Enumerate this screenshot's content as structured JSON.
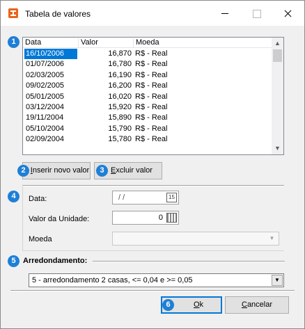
{
  "window": {
    "title": "Tabela de valores"
  },
  "markers": [
    "1",
    "2",
    "3",
    "4",
    "5",
    "6"
  ],
  "table": {
    "columns": [
      "Data",
      "Valor",
      "Moeda"
    ],
    "rows": [
      {
        "data": "16/10/2006",
        "valor": "16,870",
        "moeda": "R$ - Real"
      },
      {
        "data": "01/07/2006",
        "valor": "16,780",
        "moeda": "R$ - Real"
      },
      {
        "data": "02/03/2005",
        "valor": "16,190",
        "moeda": "R$ - Real"
      },
      {
        "data": "09/02/2005",
        "valor": "16,200",
        "moeda": "R$ - Real"
      },
      {
        "data": "05/01/2005",
        "valor": "16,020",
        "moeda": "R$ - Real"
      },
      {
        "data": "03/12/2004",
        "valor": "15,920",
        "moeda": "R$ - Real"
      },
      {
        "data": "19/11/2004",
        "valor": "15,890",
        "moeda": "R$ - Real"
      },
      {
        "data": "05/10/2004",
        "valor": "15,790",
        "moeda": "R$ - Real"
      },
      {
        "data": "02/09/2004",
        "valor": "15,780",
        "moeda": "R$ - Real"
      }
    ],
    "selected_row": 0
  },
  "buttons": {
    "insert_key": "I",
    "insert_rest": "nserir novo valor",
    "delete_key": "E",
    "delete_rest": "xcluir valor",
    "ok_key": "O",
    "ok_rest": "k",
    "cancel_key": "C",
    "cancel_rest": "ancelar"
  },
  "form": {
    "data_label": "Data:",
    "data_value": "/ /",
    "valor_label": "Valor da Unidade:",
    "valor_value": "0",
    "moeda_label": "Moeda",
    "moeda_value": ""
  },
  "arredondamento": {
    "label": "Arredondamento:",
    "selected": "5 - arredondamento 2 casas, <= 0,04 e >= 0,05"
  },
  "icons": {
    "app": "app-icon",
    "calendar": "calendar-icon",
    "calculator": "calculator-icon",
    "calendar_text": "15"
  },
  "colors": {
    "accent": "#0078d7",
    "marker": "#1e7fd6",
    "app_icon": "#e8641b"
  }
}
